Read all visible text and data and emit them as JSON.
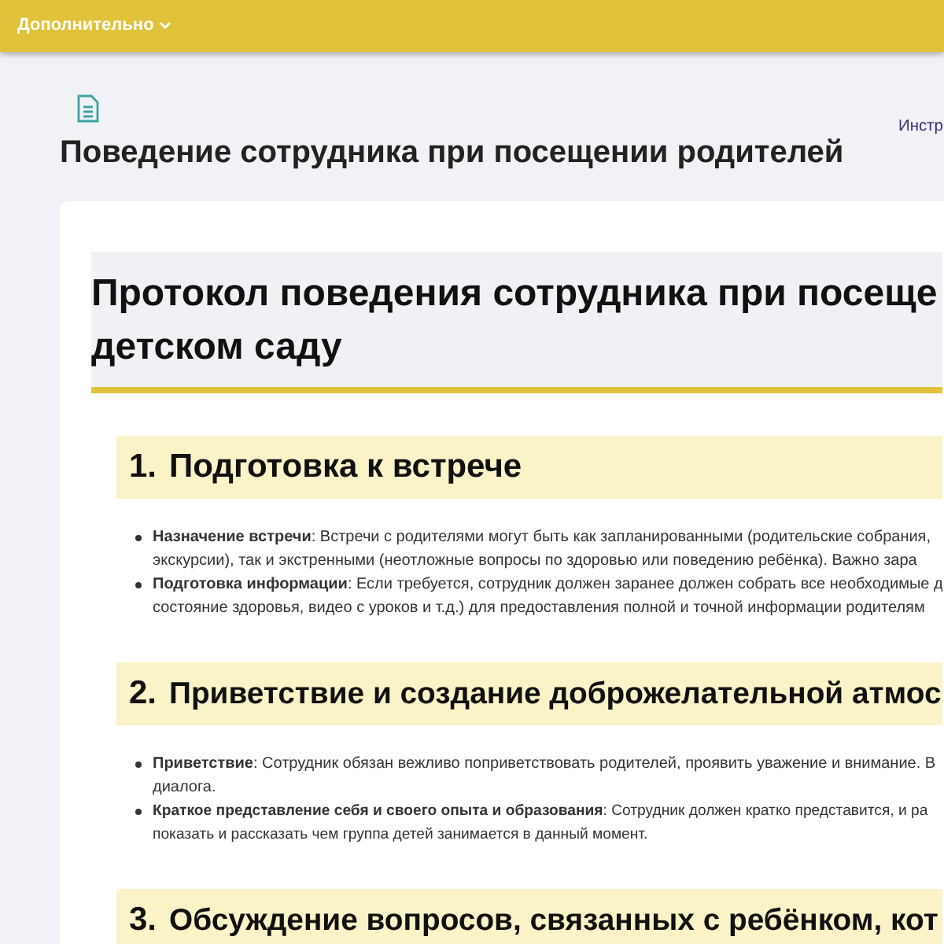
{
  "topbar": {
    "menu": "Дополнительно"
  },
  "page": {
    "title": "Поведение сотрудника при посещении родителей",
    "side_link": "Инстр"
  },
  "document": {
    "title_lines": [
      "Протокол поведения сотрудника при посеще",
      "детском саду"
    ],
    "sections": [
      {
        "number": "1.",
        "title": "Подготовка к встрече",
        "items": [
          {
            "lines": [
              "**Назначение встречи**: Встречи с родителями могут быть как запланированными (родительские собрания,",
              "экскурсии), так и экстренными (неотложные вопросы по здоровью или поведению ребёнка). Важно зара"
            ]
          },
          {
            "lines": [
              "**Подготовка информации**: Если требуется, сотрудник должен заранее должен собрать все необходимые д",
              "состояние здоровья, видео с уроков  и т.д.) для предоставления полной и точной информации родителям"
            ]
          }
        ]
      },
      {
        "number": "2.",
        "title": "Приветствие и создание доброжелательной атмос",
        "items": [
          {
            "lines": [
              "**Приветствие**: Сотрудник обязан вежливо поприветствовать родителей, проявить уважение и внимание. В",
              "диалога."
            ]
          },
          {
            "lines": [
              "**Краткое представление себя и своего опыта и образования**: Сотрудник должен кратко представится, и ра",
              "показать и рассказать чем группа детей занимается в данный момент."
            ]
          }
        ]
      },
      {
        "number": "3.",
        "title": "Обсуждение вопросов, связанных с ребёнком, кот"
      }
    ]
  }
}
